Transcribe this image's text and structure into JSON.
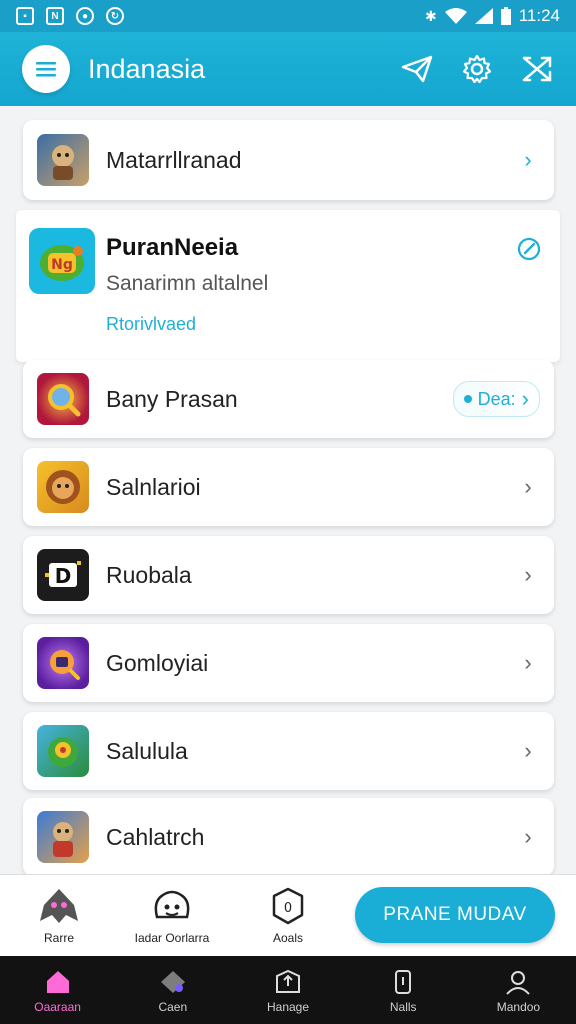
{
  "status_bar": {
    "left_icons": [
      "image-icon",
      "nfc-icon",
      "record-icon",
      "sync-icon"
    ],
    "right_icons": [
      "bluetooth-icon",
      "wifi-icon",
      "signal-icon",
      "battery-icon"
    ],
    "time": "11:24"
  },
  "app_bar": {
    "title": "Indanasia",
    "actions": [
      "send-icon",
      "gear-icon",
      "shuffle-icon"
    ]
  },
  "list": {
    "first": {
      "label": "Matarrllranad"
    },
    "featured": {
      "title": "PuranNeeia",
      "subtitle": "Sanarimn altalnel",
      "link": "Rtorivlvaed"
    },
    "items": [
      {
        "label": "Bany Prasan",
        "badge": "Dea:",
        "chevron": "accent"
      },
      {
        "label": "Salnlarioi"
      },
      {
        "label": "Ruobala"
      },
      {
        "label": "Gomloyiai"
      },
      {
        "label": "Salulula"
      },
      {
        "label": "Cahlatrch"
      }
    ]
  },
  "action_bar": {
    "actions": [
      {
        "label": "Rarre"
      },
      {
        "label": "Iadar Oorlarra"
      },
      {
        "label": "Aoals"
      }
    ],
    "cta": "PRANE MUDAV"
  },
  "nav": {
    "items": [
      {
        "label": "Oaaraan"
      },
      {
        "label": "Caen"
      },
      {
        "label": "Hanage"
      },
      {
        "label": "Nalls"
      },
      {
        "label": "Mandoo"
      }
    ]
  },
  "colors": {
    "accent": "#1aaed6",
    "appbar": "#1fb3d8",
    "nav_active": "#ff6bd6"
  }
}
